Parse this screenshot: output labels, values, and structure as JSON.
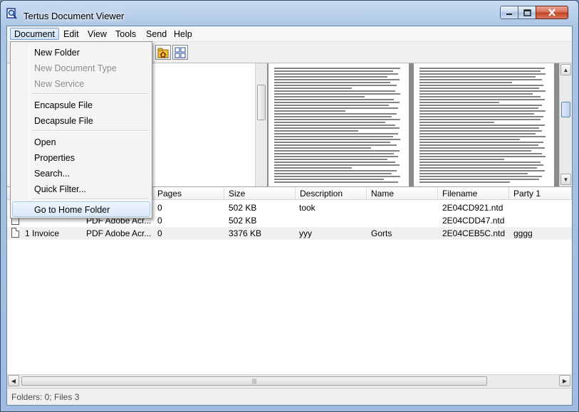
{
  "window": {
    "title": "Tertus Document Viewer"
  },
  "menubar": {
    "items": [
      "Document",
      "Edit",
      "View",
      "Tools",
      "Send",
      "Help"
    ],
    "active": "Document"
  },
  "document_menu": {
    "items": [
      {
        "label": "New Folder",
        "enabled": true
      },
      {
        "label": "New Document Type",
        "enabled": false
      },
      {
        "label": "New Service",
        "enabled": false
      },
      {
        "label": "Encapsule File",
        "enabled": true
      },
      {
        "label": "Decapsule File",
        "enabled": true
      },
      {
        "label": "Open",
        "enabled": true
      },
      {
        "label": "Properties",
        "enabled": true
      },
      {
        "label": "Search...",
        "enabled": true
      },
      {
        "label": "Quick Filter...",
        "enabled": true
      },
      {
        "label": "Go to Home Folder",
        "enabled": true,
        "highlighted": true
      }
    ]
  },
  "toolbar": {
    "buttons": [
      "folder-home-icon",
      "thumbnails-icon"
    ]
  },
  "file_list": {
    "columns": [
      "Pages",
      "Size",
      "Description",
      "Name",
      "Filename",
      "Party 1"
    ],
    "rows": [
      {
        "name": "",
        "type": "",
        "pages": "0",
        "size": "502 KB",
        "description": "took",
        "doc_name": "",
        "filename": "2E04CD921.ntd",
        "party1": ""
      },
      {
        "name": "",
        "type": "PDF Adobe Acr...",
        "pages": "0",
        "size": "502 KB",
        "description": "",
        "doc_name": "",
        "filename": "2E04CDD47.ntd",
        "party1": ""
      },
      {
        "name": "1 Invoice",
        "type": "PDF Adobe Acr...",
        "pages": "0",
        "size": "3376 KB",
        "description": "yyy",
        "doc_name": "Gorts",
        "filename": "2E04CEB5C.ntd",
        "party1": "gggg"
      }
    ]
  },
  "status": {
    "text": "Folders: 0; Files 3"
  }
}
